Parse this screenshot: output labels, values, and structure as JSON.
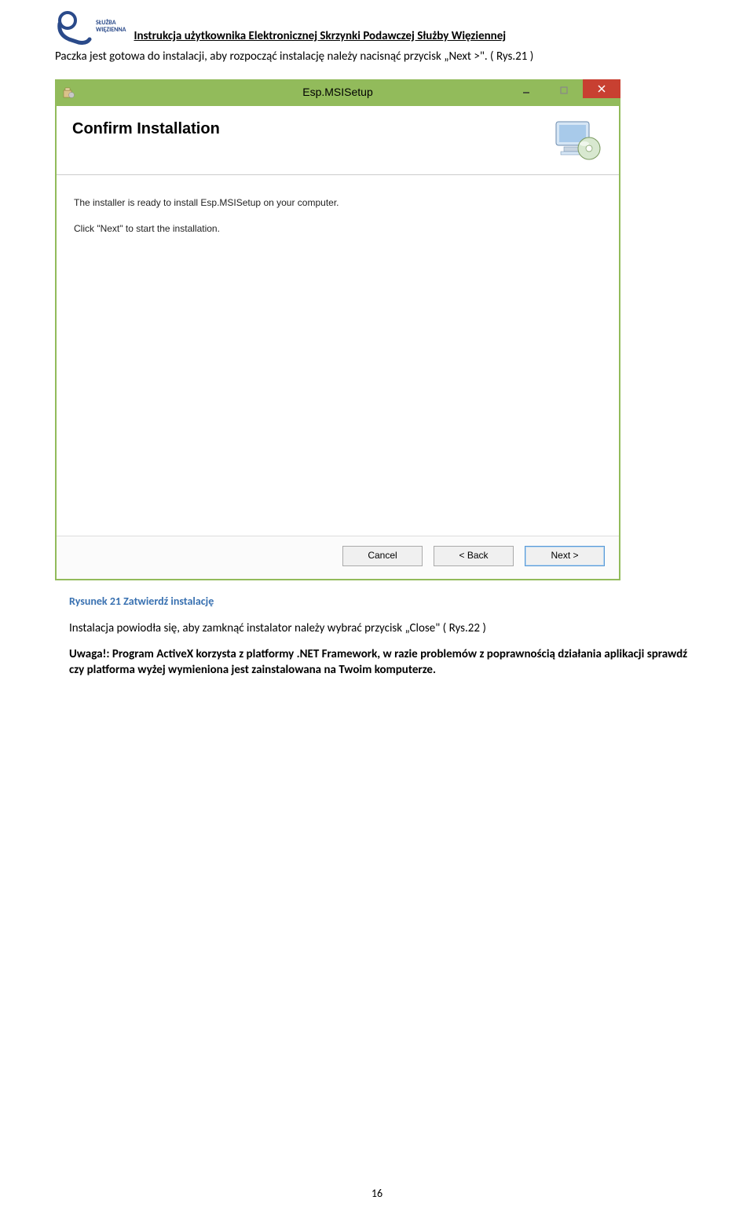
{
  "header": {
    "logo_line1": "SŁUŻBA",
    "logo_line2": "WIĘZIENNA",
    "title": "Instrukcja użytkownika Elektronicznej Skrzynki Podawczej Służby Więziennej"
  },
  "intro": "Paczka jest gotowa do instalacji, aby rozpocząć instalację należy nacisnąć przycisk „Next >\". ( Rys.21 )",
  "installer": {
    "window_title": "Esp.MSISetup",
    "banner_title": "Confirm Installation",
    "line1": "The installer is ready to install Esp.MSISetup on your computer.",
    "line2": "Click \"Next\" to start the installation.",
    "buttons": {
      "cancel": "Cancel",
      "back": "< Back",
      "next": "Next >"
    }
  },
  "caption": "Rysunek 21 Zatwierdź instalację",
  "para1": "Instalacja powiodła się, aby zamknąć instalator należy wybrać przycisk „Close\" ( Rys.22 )",
  "para2": "Uwaga!: Program ActiveX korzysta z platformy .NET Framework, w razie problemów z poprawnością działania aplikacji sprawdź czy platforma wyżej wymieniona jest zainstalowana na Twoim komputerze.",
  "page_number": "16"
}
